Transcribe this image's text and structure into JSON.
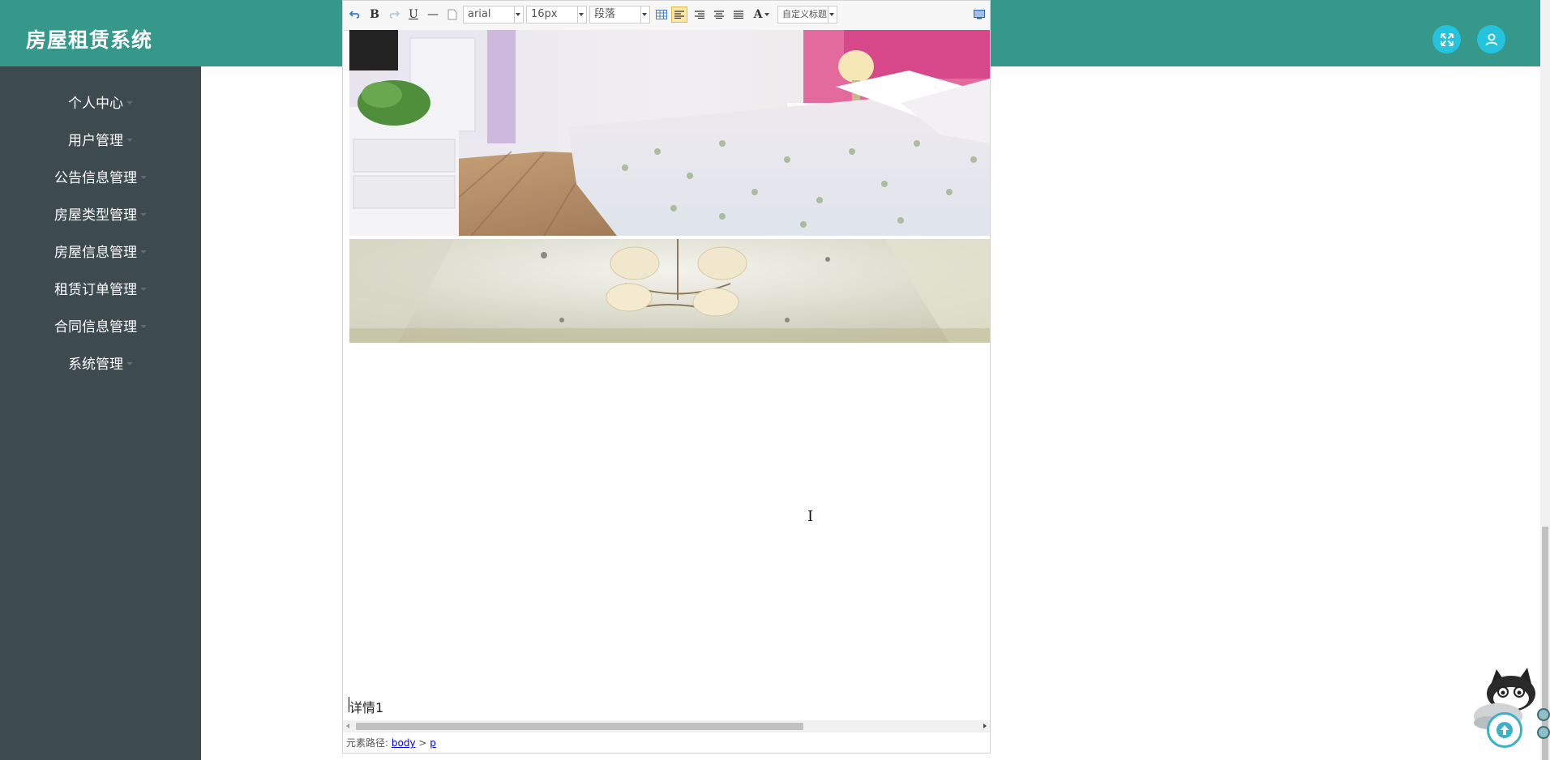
{
  "app": {
    "title": "房屋租赁系统"
  },
  "header_icons": [
    "fullscreen-icon",
    "user-icon"
  ],
  "sidebar": {
    "items": [
      {
        "label": "个人中心"
      },
      {
        "label": "用户管理"
      },
      {
        "label": "公告信息管理"
      },
      {
        "label": "房屋类型管理"
      },
      {
        "label": "房屋信息管理"
      },
      {
        "label": "租赁订单管理"
      },
      {
        "label": "合同信息管理"
      },
      {
        "label": "系统管理"
      }
    ]
  },
  "editor": {
    "toolbar": {
      "bold": "B",
      "underline": "U",
      "hr": "—",
      "font_color": "A",
      "font_family": "arial",
      "font_size": "16px",
      "paragraph": "段落",
      "custom_title": "自定义标题"
    },
    "content": {
      "detail_text": "详情1"
    },
    "status": {
      "path_label": "元素路径:",
      "path_body": "body",
      "path_sep": ">",
      "path_p": "p"
    }
  },
  "colors": {
    "header_bg": "#35988b",
    "sidebar_bg": "#3d4a4e",
    "icon_accent": "#25c3de"
  }
}
